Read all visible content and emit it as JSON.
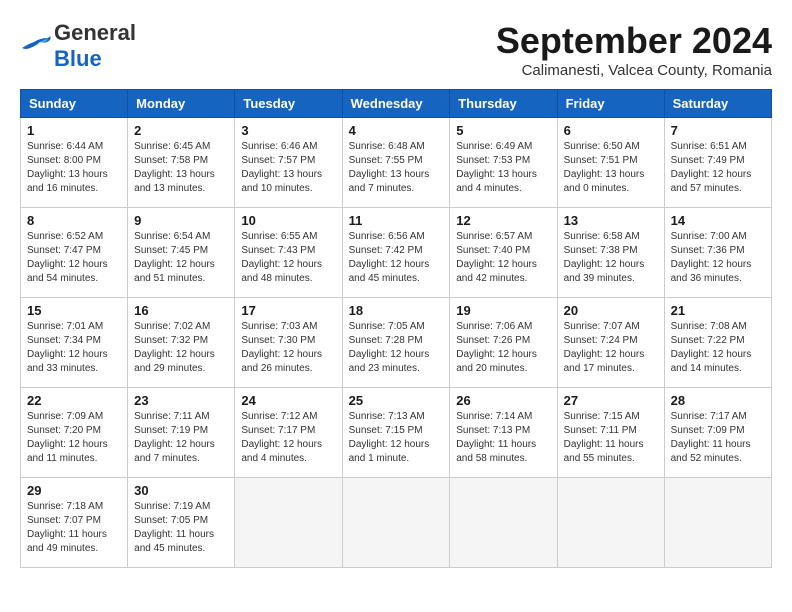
{
  "header": {
    "logo_general": "General",
    "logo_blue": "Blue",
    "month_title": "September 2024",
    "subtitle": "Calimanesti, Valcea County, Romania"
  },
  "weekdays": [
    "Sunday",
    "Monday",
    "Tuesday",
    "Wednesday",
    "Thursday",
    "Friday",
    "Saturday"
  ],
  "weeks": [
    [
      {
        "day": "1",
        "info": "Sunrise: 6:44 AM\nSunset: 8:00 PM\nDaylight: 13 hours\nand 16 minutes."
      },
      {
        "day": "2",
        "info": "Sunrise: 6:45 AM\nSunset: 7:58 PM\nDaylight: 13 hours\nand 13 minutes."
      },
      {
        "day": "3",
        "info": "Sunrise: 6:46 AM\nSunset: 7:57 PM\nDaylight: 13 hours\nand 10 minutes."
      },
      {
        "day": "4",
        "info": "Sunrise: 6:48 AM\nSunset: 7:55 PM\nDaylight: 13 hours\nand 7 minutes."
      },
      {
        "day": "5",
        "info": "Sunrise: 6:49 AM\nSunset: 7:53 PM\nDaylight: 13 hours\nand 4 minutes."
      },
      {
        "day": "6",
        "info": "Sunrise: 6:50 AM\nSunset: 7:51 PM\nDaylight: 13 hours\nand 0 minutes."
      },
      {
        "day": "7",
        "info": "Sunrise: 6:51 AM\nSunset: 7:49 PM\nDaylight: 12 hours\nand 57 minutes."
      }
    ],
    [
      {
        "day": "8",
        "info": "Sunrise: 6:52 AM\nSunset: 7:47 PM\nDaylight: 12 hours\nand 54 minutes."
      },
      {
        "day": "9",
        "info": "Sunrise: 6:54 AM\nSunset: 7:45 PM\nDaylight: 12 hours\nand 51 minutes."
      },
      {
        "day": "10",
        "info": "Sunrise: 6:55 AM\nSunset: 7:43 PM\nDaylight: 12 hours\nand 48 minutes."
      },
      {
        "day": "11",
        "info": "Sunrise: 6:56 AM\nSunset: 7:42 PM\nDaylight: 12 hours\nand 45 minutes."
      },
      {
        "day": "12",
        "info": "Sunrise: 6:57 AM\nSunset: 7:40 PM\nDaylight: 12 hours\nand 42 minutes."
      },
      {
        "day": "13",
        "info": "Sunrise: 6:58 AM\nSunset: 7:38 PM\nDaylight: 12 hours\nand 39 minutes."
      },
      {
        "day": "14",
        "info": "Sunrise: 7:00 AM\nSunset: 7:36 PM\nDaylight: 12 hours\nand 36 minutes."
      }
    ],
    [
      {
        "day": "15",
        "info": "Sunrise: 7:01 AM\nSunset: 7:34 PM\nDaylight: 12 hours\nand 33 minutes."
      },
      {
        "day": "16",
        "info": "Sunrise: 7:02 AM\nSunset: 7:32 PM\nDaylight: 12 hours\nand 29 minutes."
      },
      {
        "day": "17",
        "info": "Sunrise: 7:03 AM\nSunset: 7:30 PM\nDaylight: 12 hours\nand 26 minutes."
      },
      {
        "day": "18",
        "info": "Sunrise: 7:05 AM\nSunset: 7:28 PM\nDaylight: 12 hours\nand 23 minutes."
      },
      {
        "day": "19",
        "info": "Sunrise: 7:06 AM\nSunset: 7:26 PM\nDaylight: 12 hours\nand 20 minutes."
      },
      {
        "day": "20",
        "info": "Sunrise: 7:07 AM\nSunset: 7:24 PM\nDaylight: 12 hours\nand 17 minutes."
      },
      {
        "day": "21",
        "info": "Sunrise: 7:08 AM\nSunset: 7:22 PM\nDaylight: 12 hours\nand 14 minutes."
      }
    ],
    [
      {
        "day": "22",
        "info": "Sunrise: 7:09 AM\nSunset: 7:20 PM\nDaylight: 12 hours\nand 11 minutes."
      },
      {
        "day": "23",
        "info": "Sunrise: 7:11 AM\nSunset: 7:19 PM\nDaylight: 12 hours\nand 7 minutes."
      },
      {
        "day": "24",
        "info": "Sunrise: 7:12 AM\nSunset: 7:17 PM\nDaylight: 12 hours\nand 4 minutes."
      },
      {
        "day": "25",
        "info": "Sunrise: 7:13 AM\nSunset: 7:15 PM\nDaylight: 12 hours\nand 1 minute."
      },
      {
        "day": "26",
        "info": "Sunrise: 7:14 AM\nSunset: 7:13 PM\nDaylight: 11 hours\nand 58 minutes."
      },
      {
        "day": "27",
        "info": "Sunrise: 7:15 AM\nSunset: 7:11 PM\nDaylight: 11 hours\nand 55 minutes."
      },
      {
        "day": "28",
        "info": "Sunrise: 7:17 AM\nSunset: 7:09 PM\nDaylight: 11 hours\nand 52 minutes."
      }
    ],
    [
      {
        "day": "29",
        "info": "Sunrise: 7:18 AM\nSunset: 7:07 PM\nDaylight: 11 hours\nand 49 minutes."
      },
      {
        "day": "30",
        "info": "Sunrise: 7:19 AM\nSunset: 7:05 PM\nDaylight: 11 hours\nand 45 minutes."
      },
      {
        "day": "",
        "info": ""
      },
      {
        "day": "",
        "info": ""
      },
      {
        "day": "",
        "info": ""
      },
      {
        "day": "",
        "info": ""
      },
      {
        "day": "",
        "info": ""
      }
    ]
  ]
}
